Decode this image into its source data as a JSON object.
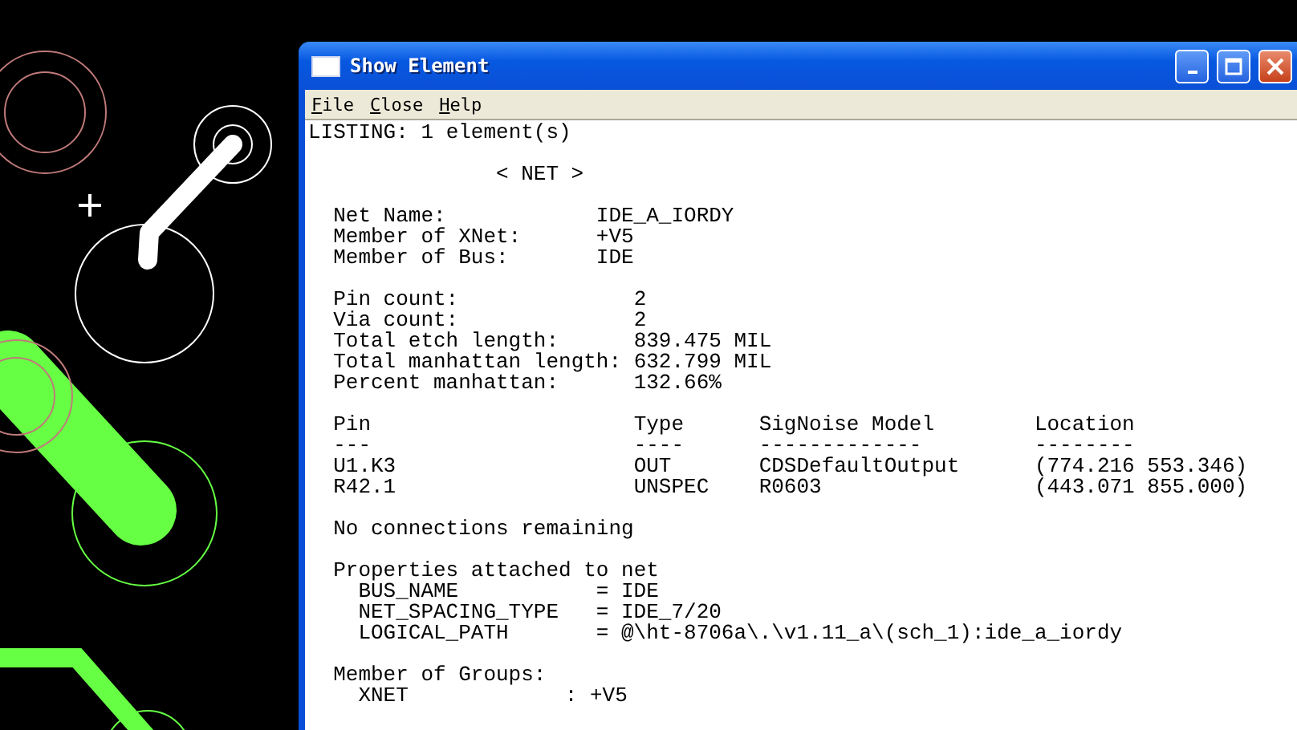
{
  "window": {
    "title": "Show Element"
  },
  "menu": [
    {
      "label": "File"
    },
    {
      "label": "Close"
    },
    {
      "label": "Help"
    }
  ],
  "listing": {
    "header": "LISTING: 1 element(s)",
    "element_type": "< NET >",
    "net_info": [
      {
        "label": "Net Name:",
        "value": "IDE_A_IORDY"
      },
      {
        "label": "Member of XNet:",
        "value": "+V5"
      },
      {
        "label": "Member of Bus:",
        "value": "IDE"
      }
    ],
    "counts": [
      {
        "label": "Pin count:",
        "value": "2"
      },
      {
        "label": "Via count:",
        "value": "2"
      },
      {
        "label": "Total etch length:",
        "value": "839.475 MIL"
      },
      {
        "label": "Total manhattan length:",
        "value": "632.799 MIL"
      },
      {
        "label": "Percent manhattan:",
        "value": "132.66%"
      }
    ],
    "pins": {
      "columns": [
        "Pin",
        "Type",
        "SigNoise Model",
        "Location"
      ],
      "rules": [
        "---",
        "----",
        "-------------",
        "--------"
      ],
      "rows": [
        [
          "U1.K3",
          "OUT",
          "CDSDefaultOutput",
          "(774.216 553.346)"
        ],
        [
          "R42.1",
          "UNSPEC",
          "R0603",
          "(443.071 855.000)"
        ]
      ]
    },
    "connections": "No connections remaining",
    "properties": {
      "title": "Properties attached to net",
      "items": [
        {
          "name": "BUS_NAME",
          "value": "= IDE"
        },
        {
          "name": "NET_SPACING_TYPE",
          "value": "= IDE_7/20"
        },
        {
          "name": "LOGICAL_PATH",
          "value": "= @\\ht-8706a\\.\\v1.11_a\\(sch_1):ide_a_iordy"
        }
      ]
    },
    "groups": {
      "title": "Member of Groups:",
      "items": [
        {
          "name": "XNET",
          "value": ": +V5"
        }
      ]
    }
  }
}
